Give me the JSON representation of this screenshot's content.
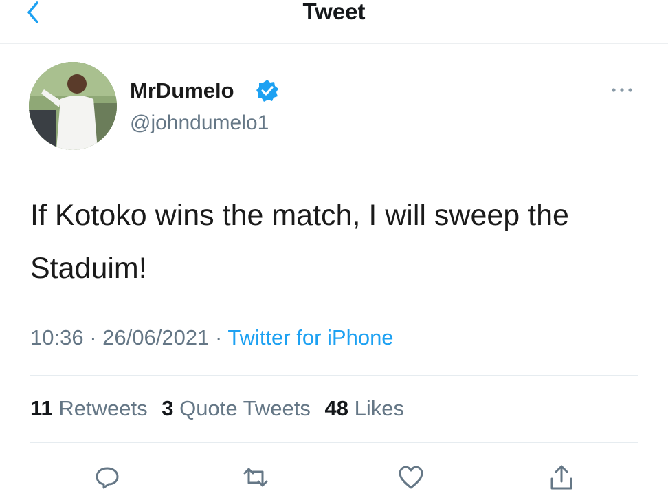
{
  "header": {
    "title": "Tweet",
    "back_icon": "chevron-left-icon"
  },
  "author": {
    "name": "MrDumelo",
    "handle": "@johndumelo1",
    "verified_icon": "verified-badge-icon",
    "more_icon": "more-horizontal-icon"
  },
  "tweet": {
    "text": "If Kotoko wins the match, I will sweep the Staduim!"
  },
  "meta": {
    "time": "10:36",
    "separator": "·",
    "date": "26/06/2021",
    "source": "Twitter for iPhone"
  },
  "stats": {
    "retweets_count": "11",
    "retweets_label": "Retweets",
    "quotes_count": "3",
    "quotes_label": "Quote Tweets",
    "likes_count": "48",
    "likes_label": "Likes"
  },
  "actions": [
    "reply-icon",
    "retweet-icon",
    "like-icon",
    "share-icon"
  ],
  "colors": {
    "accent": "#1da1f2",
    "secondary_text": "#657786",
    "divider": "#e6ecf0"
  }
}
